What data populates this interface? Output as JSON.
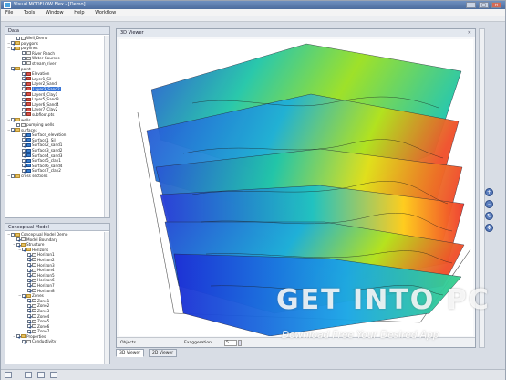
{
  "window": {
    "title": "Visual MODFLOW Flex - [Demo]"
  },
  "menu": [
    "File",
    "Tools",
    "Window",
    "Help",
    "Workflow"
  ],
  "left_top": {
    "tab_label": "Data",
    "items": [
      {
        "label": "Well_Demo",
        "indent": 1,
        "icon": "doc",
        "checked": false
      },
      {
        "label": "polygons",
        "indent": 0,
        "icon": "folder",
        "checked": true
      },
      {
        "label": "polylines",
        "indent": 0,
        "icon": "folder",
        "checked": true
      },
      {
        "label": "River Reach",
        "indent": 2,
        "icon": "doc",
        "checked": false
      },
      {
        "label": "Water Courses",
        "indent": 2,
        "icon": "doc",
        "checked": false
      },
      {
        "label": "stream_river",
        "indent": 2,
        "icon": "doc",
        "checked": false
      },
      {
        "label": "point",
        "indent": 0,
        "icon": "folder",
        "checked": true
      },
      {
        "label": "Elevation",
        "indent": 2,
        "icon": "layer",
        "checked": true
      },
      {
        "label": "Layer1_Sil",
        "indent": 2,
        "icon": "layer",
        "checked": true
      },
      {
        "label": "Layer2_Sand",
        "indent": 2,
        "icon": "layer",
        "checked": true
      },
      {
        "label": "Layer3_Sand2",
        "indent": 2,
        "icon": "layer",
        "checked": true,
        "selected": true
      },
      {
        "label": "Layer4_Clay1",
        "indent": 2,
        "icon": "layer",
        "checked": true
      },
      {
        "label": "Layer5_Sand3",
        "indent": 2,
        "icon": "layer",
        "checked": true
      },
      {
        "label": "Layer6_Sand4",
        "indent": 2,
        "icon": "layer",
        "checked": true
      },
      {
        "label": "Layer7_Clay2",
        "indent": 2,
        "icon": "layer",
        "checked": true
      },
      {
        "label": "subfloor.pts",
        "indent": 2,
        "icon": "layer",
        "checked": false
      },
      {
        "label": "wells",
        "indent": 0,
        "icon": "folder",
        "checked": true
      },
      {
        "label": "pumping wells",
        "indent": 1,
        "icon": "doc",
        "checked": false
      },
      {
        "label": "surfaces",
        "indent": 0,
        "icon": "folder",
        "checked": true
      },
      {
        "label": "Surface_elevation",
        "indent": 2,
        "icon": "surface",
        "checked": true
      },
      {
        "label": "Surface1_Sil",
        "indent": 2,
        "icon": "surface",
        "checked": true
      },
      {
        "label": "Surface2_sand1",
        "indent": 2,
        "icon": "surface",
        "checked": true
      },
      {
        "label": "Surface3_sand2",
        "indent": 2,
        "icon": "surface",
        "checked": true
      },
      {
        "label": "Surface4_sand3",
        "indent": 2,
        "icon": "surface",
        "checked": true
      },
      {
        "label": "Surface5_clay1",
        "indent": 2,
        "icon": "surface",
        "checked": true
      },
      {
        "label": "Surface6_sand4",
        "indent": 2,
        "icon": "surface",
        "checked": true
      },
      {
        "label": "Surface7_clay2",
        "indent": 2,
        "icon": "surface",
        "checked": true
      },
      {
        "label": "cross sections",
        "indent": 0,
        "icon": "folder",
        "checked": false
      }
    ]
  },
  "left_bottom": {
    "tab_label": "Conceptual Model",
    "items": [
      {
        "label": "Conceptual Model Demo",
        "indent": 0,
        "icon": "folder",
        "checked": false
      },
      {
        "label": "Model Boundary",
        "indent": 1,
        "icon": "doc",
        "checked": true
      },
      {
        "label": "Structure",
        "indent": 1,
        "icon": "folder",
        "checked": true
      },
      {
        "label": "Horizons",
        "indent": 2,
        "icon": "folder",
        "checked": true
      },
      {
        "label": "Horizon1",
        "indent": 3,
        "icon": "doc",
        "checked": true
      },
      {
        "label": "Horizon2",
        "indent": 3,
        "icon": "doc",
        "checked": true
      },
      {
        "label": "Horizon3",
        "indent": 3,
        "icon": "doc",
        "checked": true
      },
      {
        "label": "Horizon4",
        "indent": 3,
        "icon": "doc",
        "checked": true
      },
      {
        "label": "Horizon5",
        "indent": 3,
        "icon": "doc",
        "checked": true
      },
      {
        "label": "Horizon6",
        "indent": 3,
        "icon": "doc",
        "checked": true
      },
      {
        "label": "Horizon7",
        "indent": 3,
        "icon": "doc",
        "checked": true
      },
      {
        "label": "Horizon8",
        "indent": 3,
        "icon": "doc",
        "checked": true
      },
      {
        "label": "Zones",
        "indent": 2,
        "icon": "folder",
        "checked": true
      },
      {
        "label": "Zone1",
        "indent": 3,
        "icon": "doc",
        "checked": true
      },
      {
        "label": "Zone2",
        "indent": 3,
        "icon": "doc",
        "checked": true
      },
      {
        "label": "Zone3",
        "indent": 3,
        "icon": "doc",
        "checked": true
      },
      {
        "label": "Zone4",
        "indent": 3,
        "icon": "doc",
        "checked": true
      },
      {
        "label": "Zone5",
        "indent": 3,
        "icon": "doc",
        "checked": true
      },
      {
        "label": "Zone6",
        "indent": 3,
        "icon": "doc",
        "checked": true
      },
      {
        "label": "Zone7",
        "indent": 3,
        "icon": "doc",
        "checked": true
      },
      {
        "label": "Properties",
        "indent": 1,
        "icon": "folder",
        "checked": true
      },
      {
        "label": "Conductivity",
        "indent": 2,
        "icon": "doc",
        "checked": true
      }
    ]
  },
  "viewer": {
    "tab_label": "3D Viewer",
    "objects_label": "Objects",
    "exaggeration_label": "Exaggeration:",
    "exaggeration_value": "5"
  },
  "bottom_tabs": [
    "3D Viewer",
    "2D Viewer"
  ],
  "watermark": {
    "title": "GET INTO PC",
    "subtitle": "Download Free Your Desired App"
  },
  "colors": {
    "surface_low": "#2a52d6",
    "surface_mid": "#22c6a8",
    "surface_mid2": "#9be021",
    "surface_high": "#f0502a",
    "selection": "#3875d7"
  }
}
